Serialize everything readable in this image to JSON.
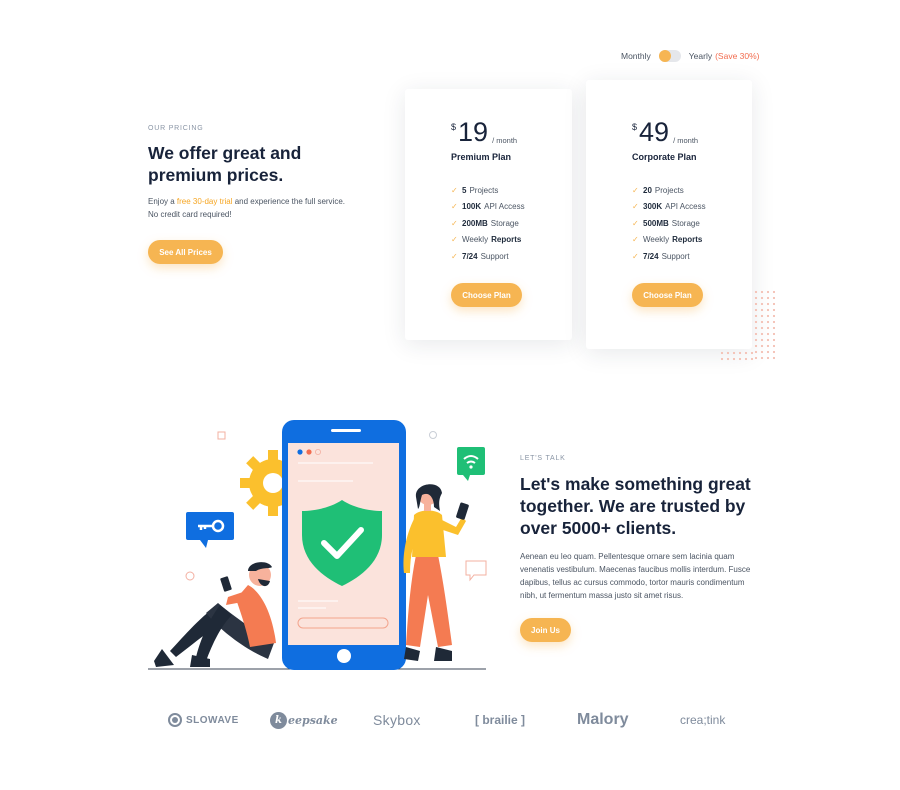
{
  "billing": {
    "monthly_label": "Monthly",
    "yearly_label": "Yearly",
    "save_label": "(Save 30%)"
  },
  "pricing_intro": {
    "eyebrow": "OUR PRICING",
    "title_line1": "We offer great and",
    "title_line2": "premium prices.",
    "desc_pre": "Enjoy a ",
    "desc_highlight": "free 30-day trial",
    "desc_post": " and experience the full service. No credit card required!",
    "button": "See All Prices"
  },
  "plans": [
    {
      "currency": "$",
      "amount": "19",
      "period": "/ month",
      "name": "Premium Plan",
      "features": [
        {
          "bold": "5",
          "text": "Projects"
        },
        {
          "bold": "100K",
          "text": "API Access"
        },
        {
          "bold": "200MB",
          "text": "Storage"
        },
        {
          "bold": "",
          "text": "Weekly",
          "bold_after": "Reports"
        },
        {
          "bold": "7/24",
          "text": "Support"
        }
      ],
      "button": "Choose Plan"
    },
    {
      "currency": "$",
      "amount": "49",
      "period": "/ month",
      "name": "Corporate Plan",
      "features": [
        {
          "bold": "20",
          "text": "Projects"
        },
        {
          "bold": "300K",
          "text": "API Access"
        },
        {
          "bold": "500MB",
          "text": "Storage"
        },
        {
          "bold": "",
          "text": "Weekly",
          "bold_after": "Reports"
        },
        {
          "bold": "7/24",
          "text": "Support"
        }
      ],
      "button": "Choose Plan"
    }
  ],
  "talk": {
    "eyebrow": "LET'S TALK",
    "title_line1": "Let's make something great",
    "title_line2": "together. We are trusted by",
    "title_line3": "over 5000+ clients.",
    "body": "Aenean eu leo quam. Pellentesque ornare sem lacinia quam venenatis vestibulum. Maecenas faucibus mollis interdum. Fusce dapibus, tellus ac cursus commodo, tortor mauris condimentum nibh, ut fermentum massa justo sit amet risus.",
    "button": "Join Us"
  },
  "logos": {
    "slowave": "SLOWAVE",
    "keepsake_k": "k",
    "keepsake": "eepsake",
    "skybox": "Skybox",
    "brailie": "[ brailie ]",
    "malory": "Malory",
    "creatink": "crea;tink"
  },
  "colors": {
    "accent": "#f6b552",
    "save": "#f26c4f",
    "phone_blue": "#0f6ee0",
    "shield_green": "#1fbf76",
    "heading": "#18233a"
  },
  "icons": [
    "check-icon",
    "gear-icon",
    "key-icon",
    "wifi-icon",
    "shield-check-icon",
    "chat-bubble-icon"
  ]
}
